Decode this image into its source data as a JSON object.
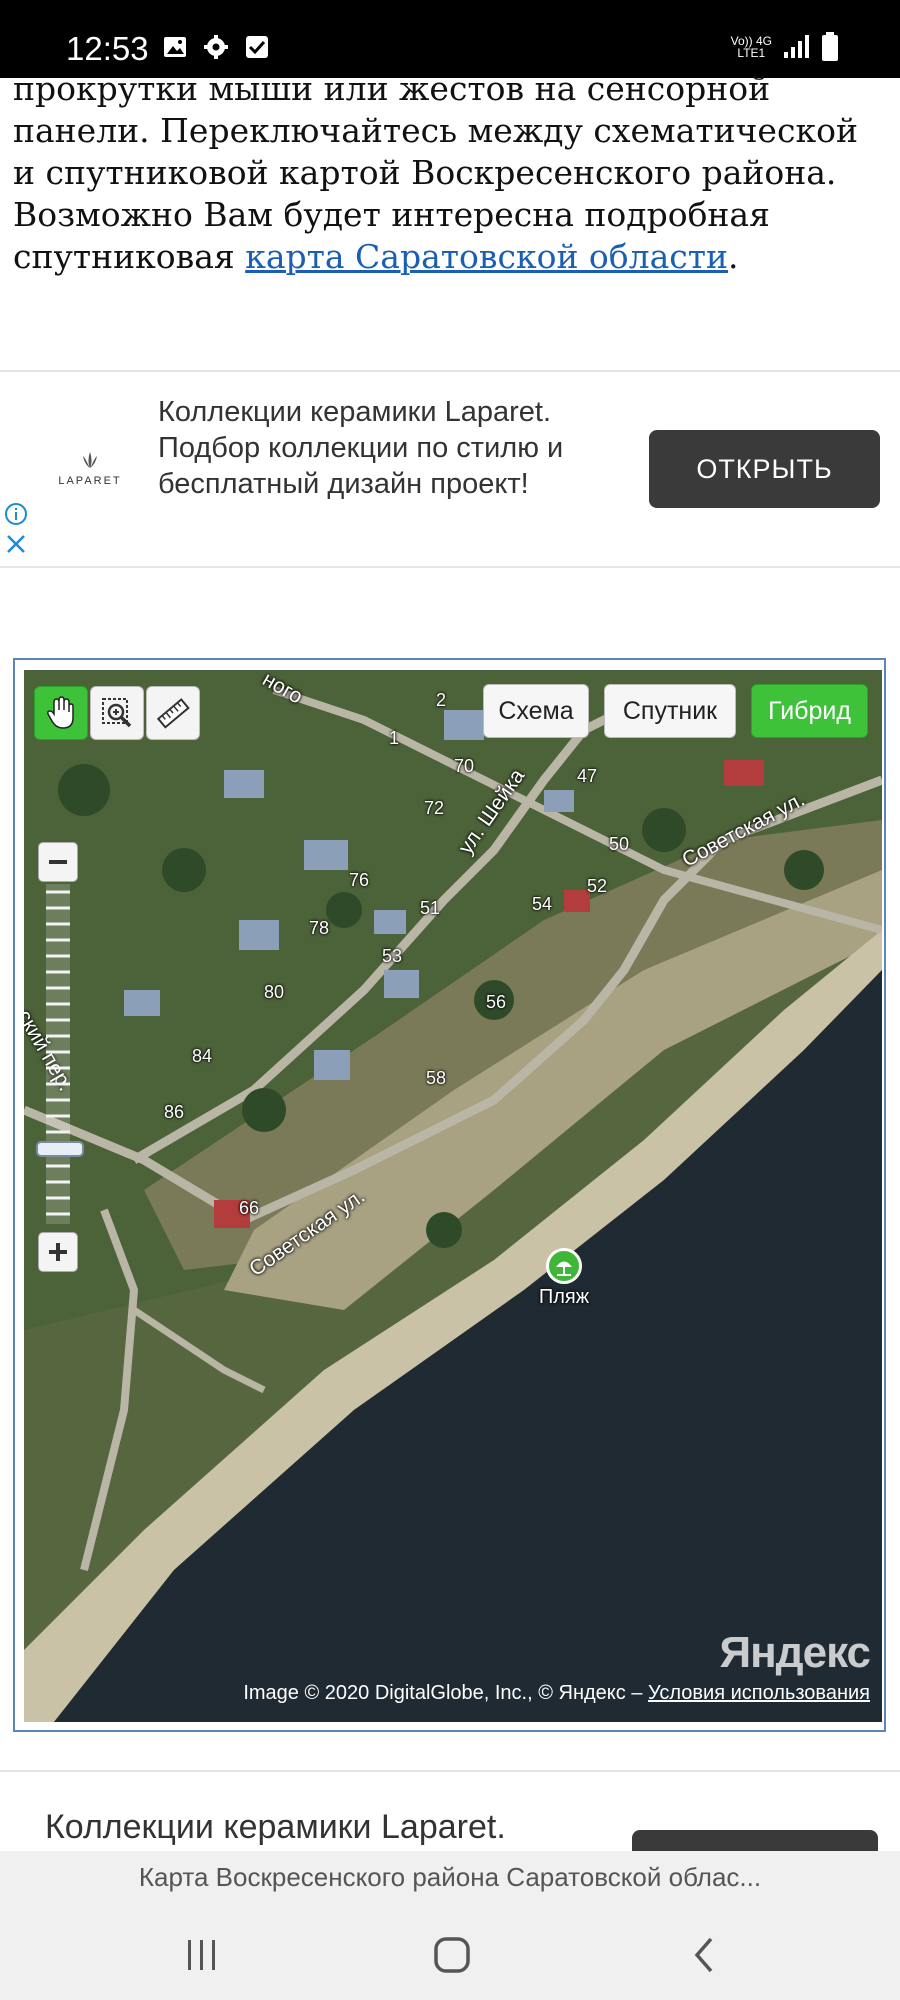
{
  "status_bar": {
    "time": "12:53",
    "network_top": "Vo)) 4G",
    "network_bottom": "LTE1",
    "icons": [
      "image-icon",
      "gear-icon",
      "checkbox-icon",
      "signal-icon",
      "battery-icon"
    ]
  },
  "article": {
    "text_before": "прокрутки мыши или жестов на сенсорной панели. Переключайтесь между схематической и спутниковой картой Воскресенского района. Возможно Вам будет интересна подробная спутниковая ",
    "link_text": "карта Саратовской области",
    "text_after": "."
  },
  "ad_top": {
    "logo_text": "LAPARET",
    "text": "Коллекции керамики Laparet. Подбор коллекции по стилю и бесплатный дизайн проект!",
    "button": "ОТКРЫТЬ"
  },
  "map": {
    "tools": [
      "hand-tool",
      "zoom-select-tool",
      "ruler-tool"
    ],
    "type_buttons": {
      "scheme": "Схема",
      "satellite": "Спутник",
      "hybrid": "Гибрид"
    },
    "active_type": "hybrid",
    "zoom_level_fraction": 0.22,
    "labels": {
      "street_sheika": "ул. Шейка",
      "street_sovetskaya_upper": "Советская ул.",
      "street_sovetskaya_lower": "Советская ул.",
      "street_lane": "ский пер.",
      "street_top": "ного"
    },
    "house_numbers": {
      "n2": "2",
      "n1": "1",
      "n70": "70",
      "n47": "47",
      "n72": "72",
      "n50": "50",
      "n76": "76",
      "n52": "52",
      "n54": "54",
      "n51": "51",
      "n78": "78",
      "n53": "53",
      "n80": "80",
      "n56": "56",
      "n84": "84",
      "n58": "58",
      "n86": "86",
      "n66": "66"
    },
    "beach_label": "Пляж",
    "logo": "Яндекс",
    "copyright": "Image © 2020 DigitalGlobe, Inc., © Яндекс – ",
    "terms": "Условия использования"
  },
  "ad_bottom": {
    "text": "Коллекции керамики Laparet."
  },
  "browser": {
    "page_title": "Карта Воскресенского района Саратовской облас..."
  },
  "colors": {
    "link": "#1a5fb4",
    "active_green": "#3ec23a",
    "ad_button": "#3a3a3a",
    "water": "#1f2a32"
  }
}
